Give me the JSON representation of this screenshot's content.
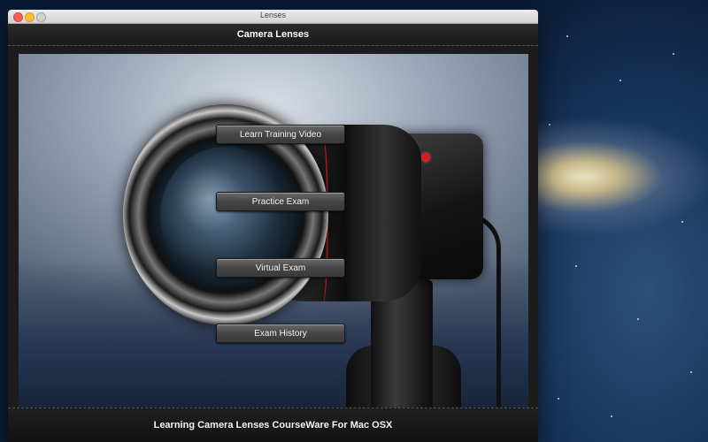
{
  "window": {
    "title": "Lenses",
    "controls": {
      "close_icon": "close-icon",
      "minimize_icon": "minimize-icon",
      "maximize_icon": "maximize-icon"
    }
  },
  "header": {
    "title": "Camera Lenses"
  },
  "menu": {
    "buttons": [
      {
        "label": "Learn Training Video"
      },
      {
        "label": "Practice Exam"
      },
      {
        "label": "Virtual Exam"
      },
      {
        "label": "Exam History"
      }
    ]
  },
  "footer": {
    "text": "Learning Camera Lenses CourseWare For Mac OSX"
  },
  "colors": {
    "accent_red": "#c61f1f",
    "background_dark": "#1c1c1c"
  }
}
